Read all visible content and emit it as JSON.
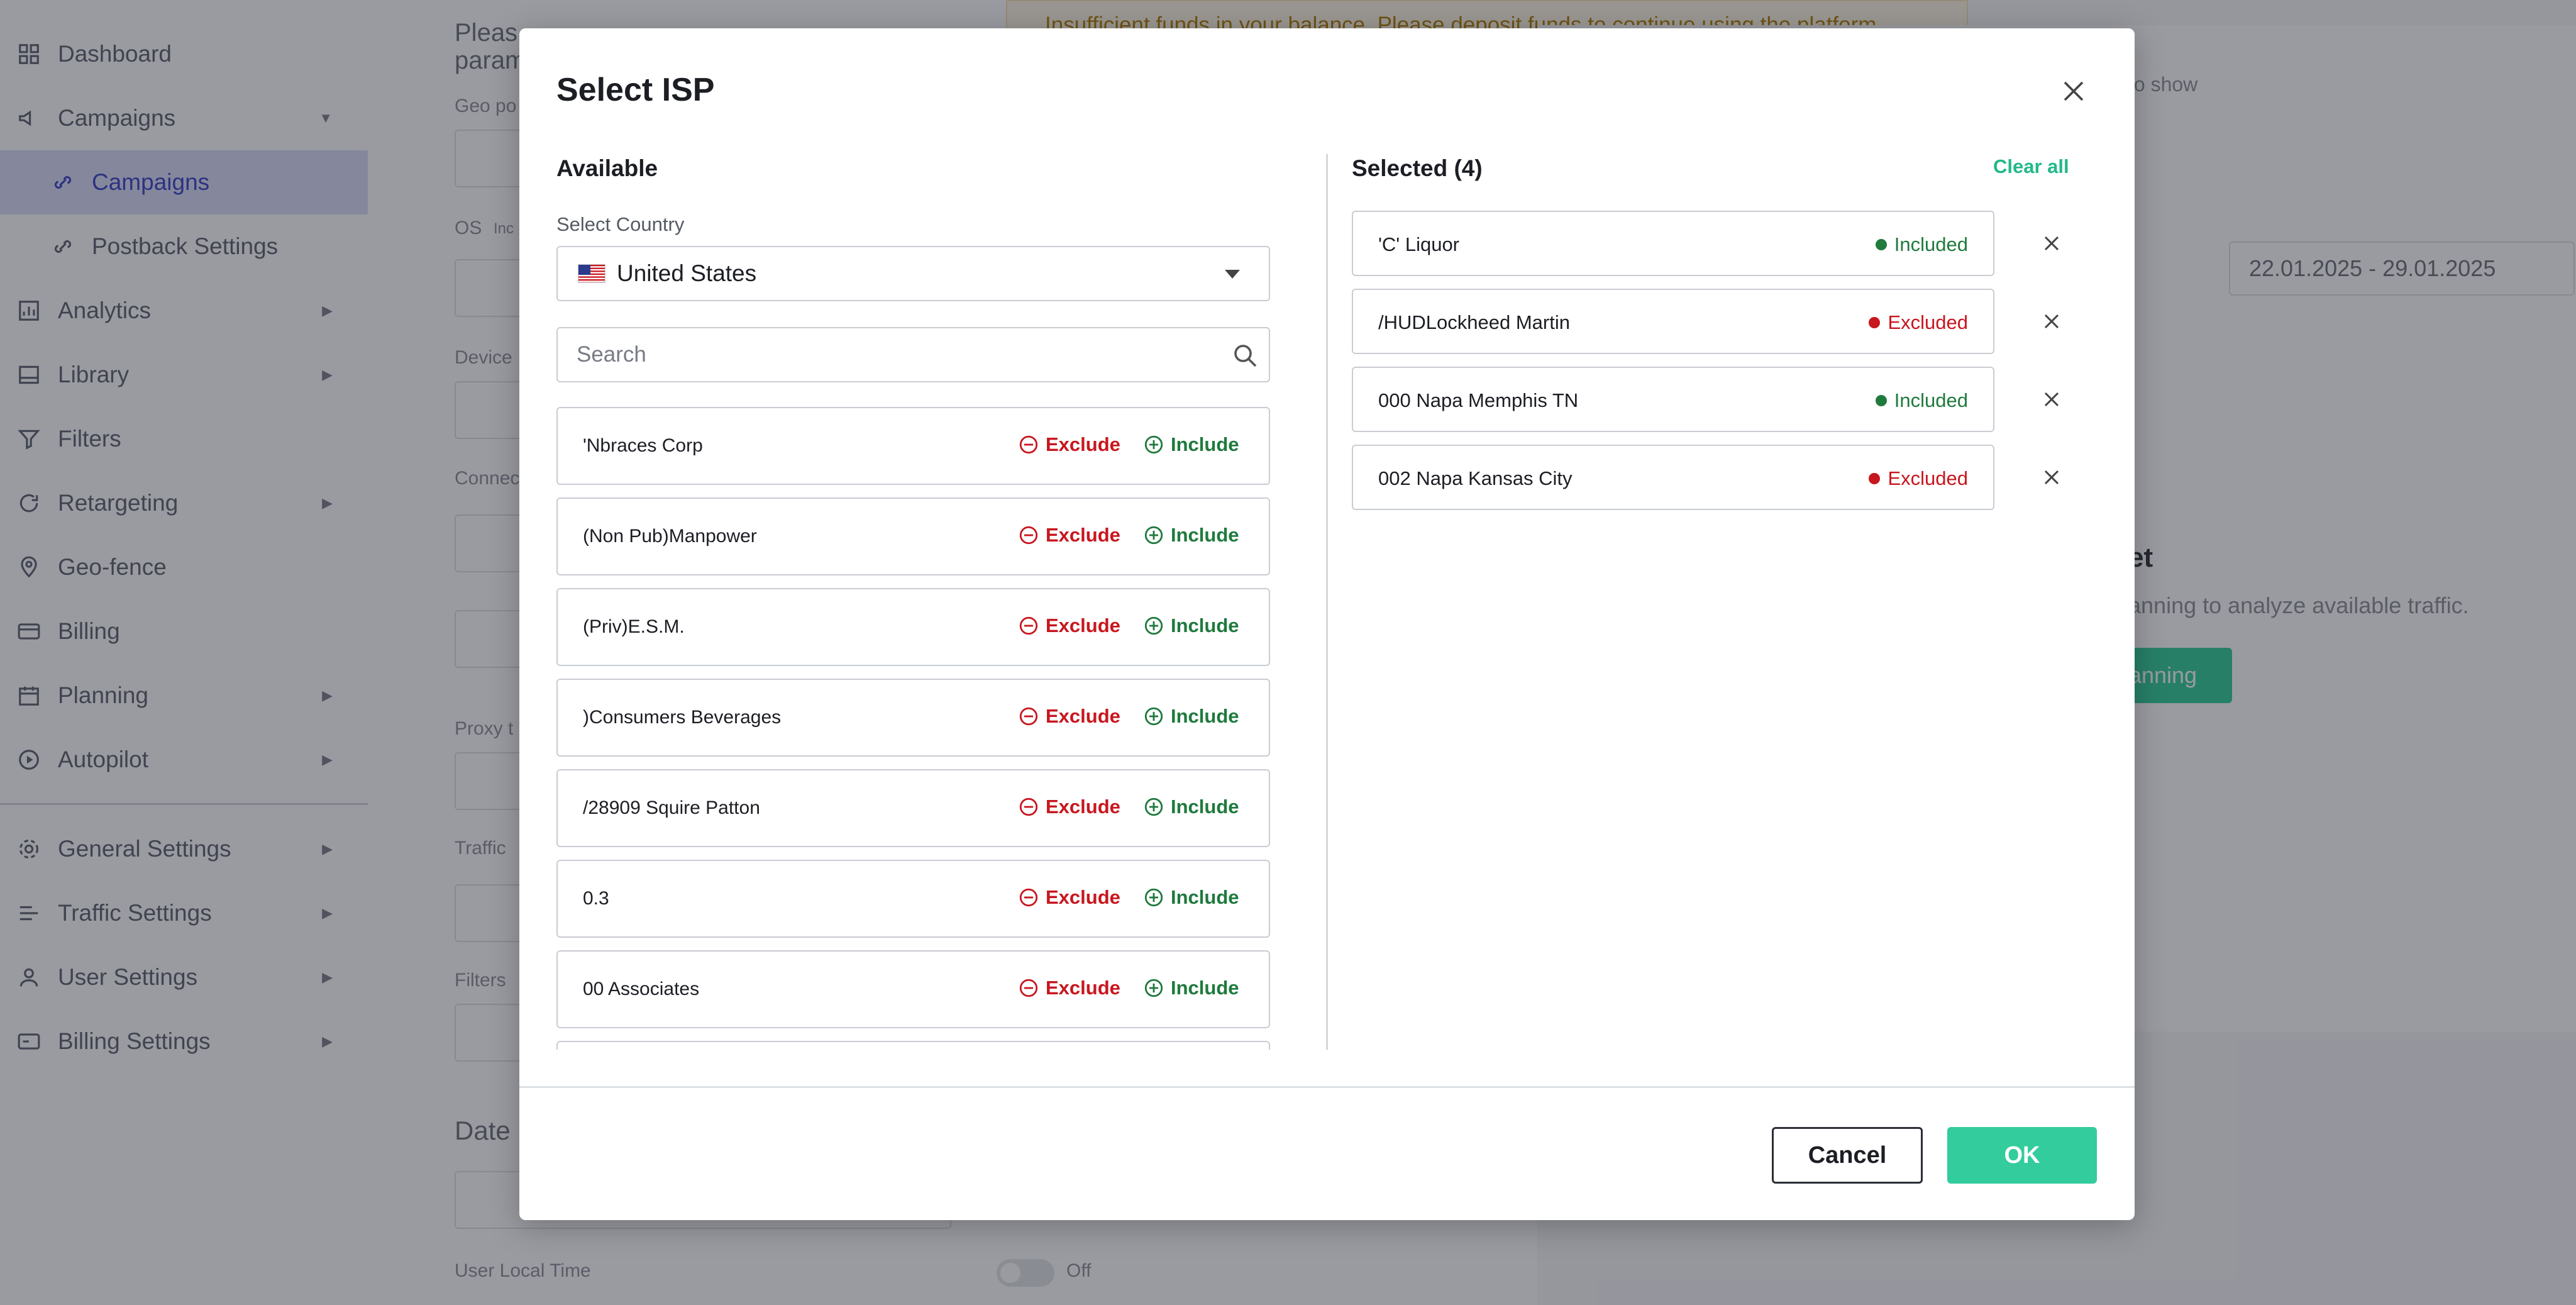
{
  "sidebar": {
    "items": [
      {
        "label": "Dashboard",
        "icon": "dashboard-icon"
      },
      {
        "label": "Campaigns",
        "icon": "megaphone-icon"
      },
      {
        "label": "Campaigns",
        "icon": "link-icon"
      },
      {
        "label": "Postback Settings",
        "icon": "link-icon"
      },
      {
        "label": "Analytics",
        "icon": "chart-icon"
      },
      {
        "label": "Library",
        "icon": "library-icon"
      },
      {
        "label": "Filters",
        "icon": "filter-icon"
      },
      {
        "label": "Retargeting",
        "icon": "retarget-icon"
      },
      {
        "label": "Geo-fence",
        "icon": "pin-icon"
      },
      {
        "label": "Billing",
        "icon": "card-icon"
      },
      {
        "label": "Planning",
        "icon": "calendar-icon"
      },
      {
        "label": "Autopilot",
        "icon": "play-icon"
      },
      {
        "label": "General Settings",
        "icon": "gear-icon"
      },
      {
        "label": "Traffic Settings",
        "icon": "traffic-icon"
      },
      {
        "label": "User Settings",
        "icon": "user-icon"
      },
      {
        "label": "Billing Settings",
        "icon": "billing-icon"
      }
    ]
  },
  "background": {
    "intro_text": "Pleas",
    "intro_text_2": "param",
    "alert_text": "Insufficient funds in your balance. Please deposit funds to continue using the platform",
    "labels": {
      "geo": "Geo po",
      "os": "OS",
      "os_hint": "Inc",
      "device": "Device",
      "connection": "Connec",
      "proxy": "Proxy t",
      "traffic": "Traffic",
      "filters": "Filters",
      "date": "Date",
      "user_local_time": "User Local Time",
      "toggle_state": "Off"
    },
    "no_data_text": "to show",
    "date_range": "22.01.2025 - 29.01.2025",
    "planning_heading": "et",
    "planning_hint": "anning to analyze available traffic.",
    "planning_button": "anning"
  },
  "modal": {
    "title": "Select ISP",
    "available_title": "Available",
    "select_country_label": "Select Country",
    "country": "United States",
    "search_placeholder": "Search",
    "exclude_label": "Exclude",
    "include_label": "Include",
    "available_items": [
      "'Nbraces Corp",
      "(Non Pub)Manpower",
      "(Priv)E.S.M.",
      ")Consumers Beverages",
      "/28909 Squire Patton",
      "0.3",
      "00 Associates"
    ],
    "selected_title": "Selected (4)",
    "clear_all": "Clear all",
    "selected_items": [
      {
        "name": "'C' Liquor",
        "status": "Included"
      },
      {
        "name": "/HUDLockheed Martin",
        "status": "Excluded"
      },
      {
        "name": "000 Napa Memphis TN",
        "status": "Included"
      },
      {
        "name": "002 Napa Kansas City",
        "status": "Excluded"
      }
    ],
    "cancel_label": "Cancel",
    "ok_label": "OK"
  },
  "colors": {
    "accent": "#33cc9c",
    "exclude": "#c8161e",
    "include": "#1f7a3d"
  }
}
